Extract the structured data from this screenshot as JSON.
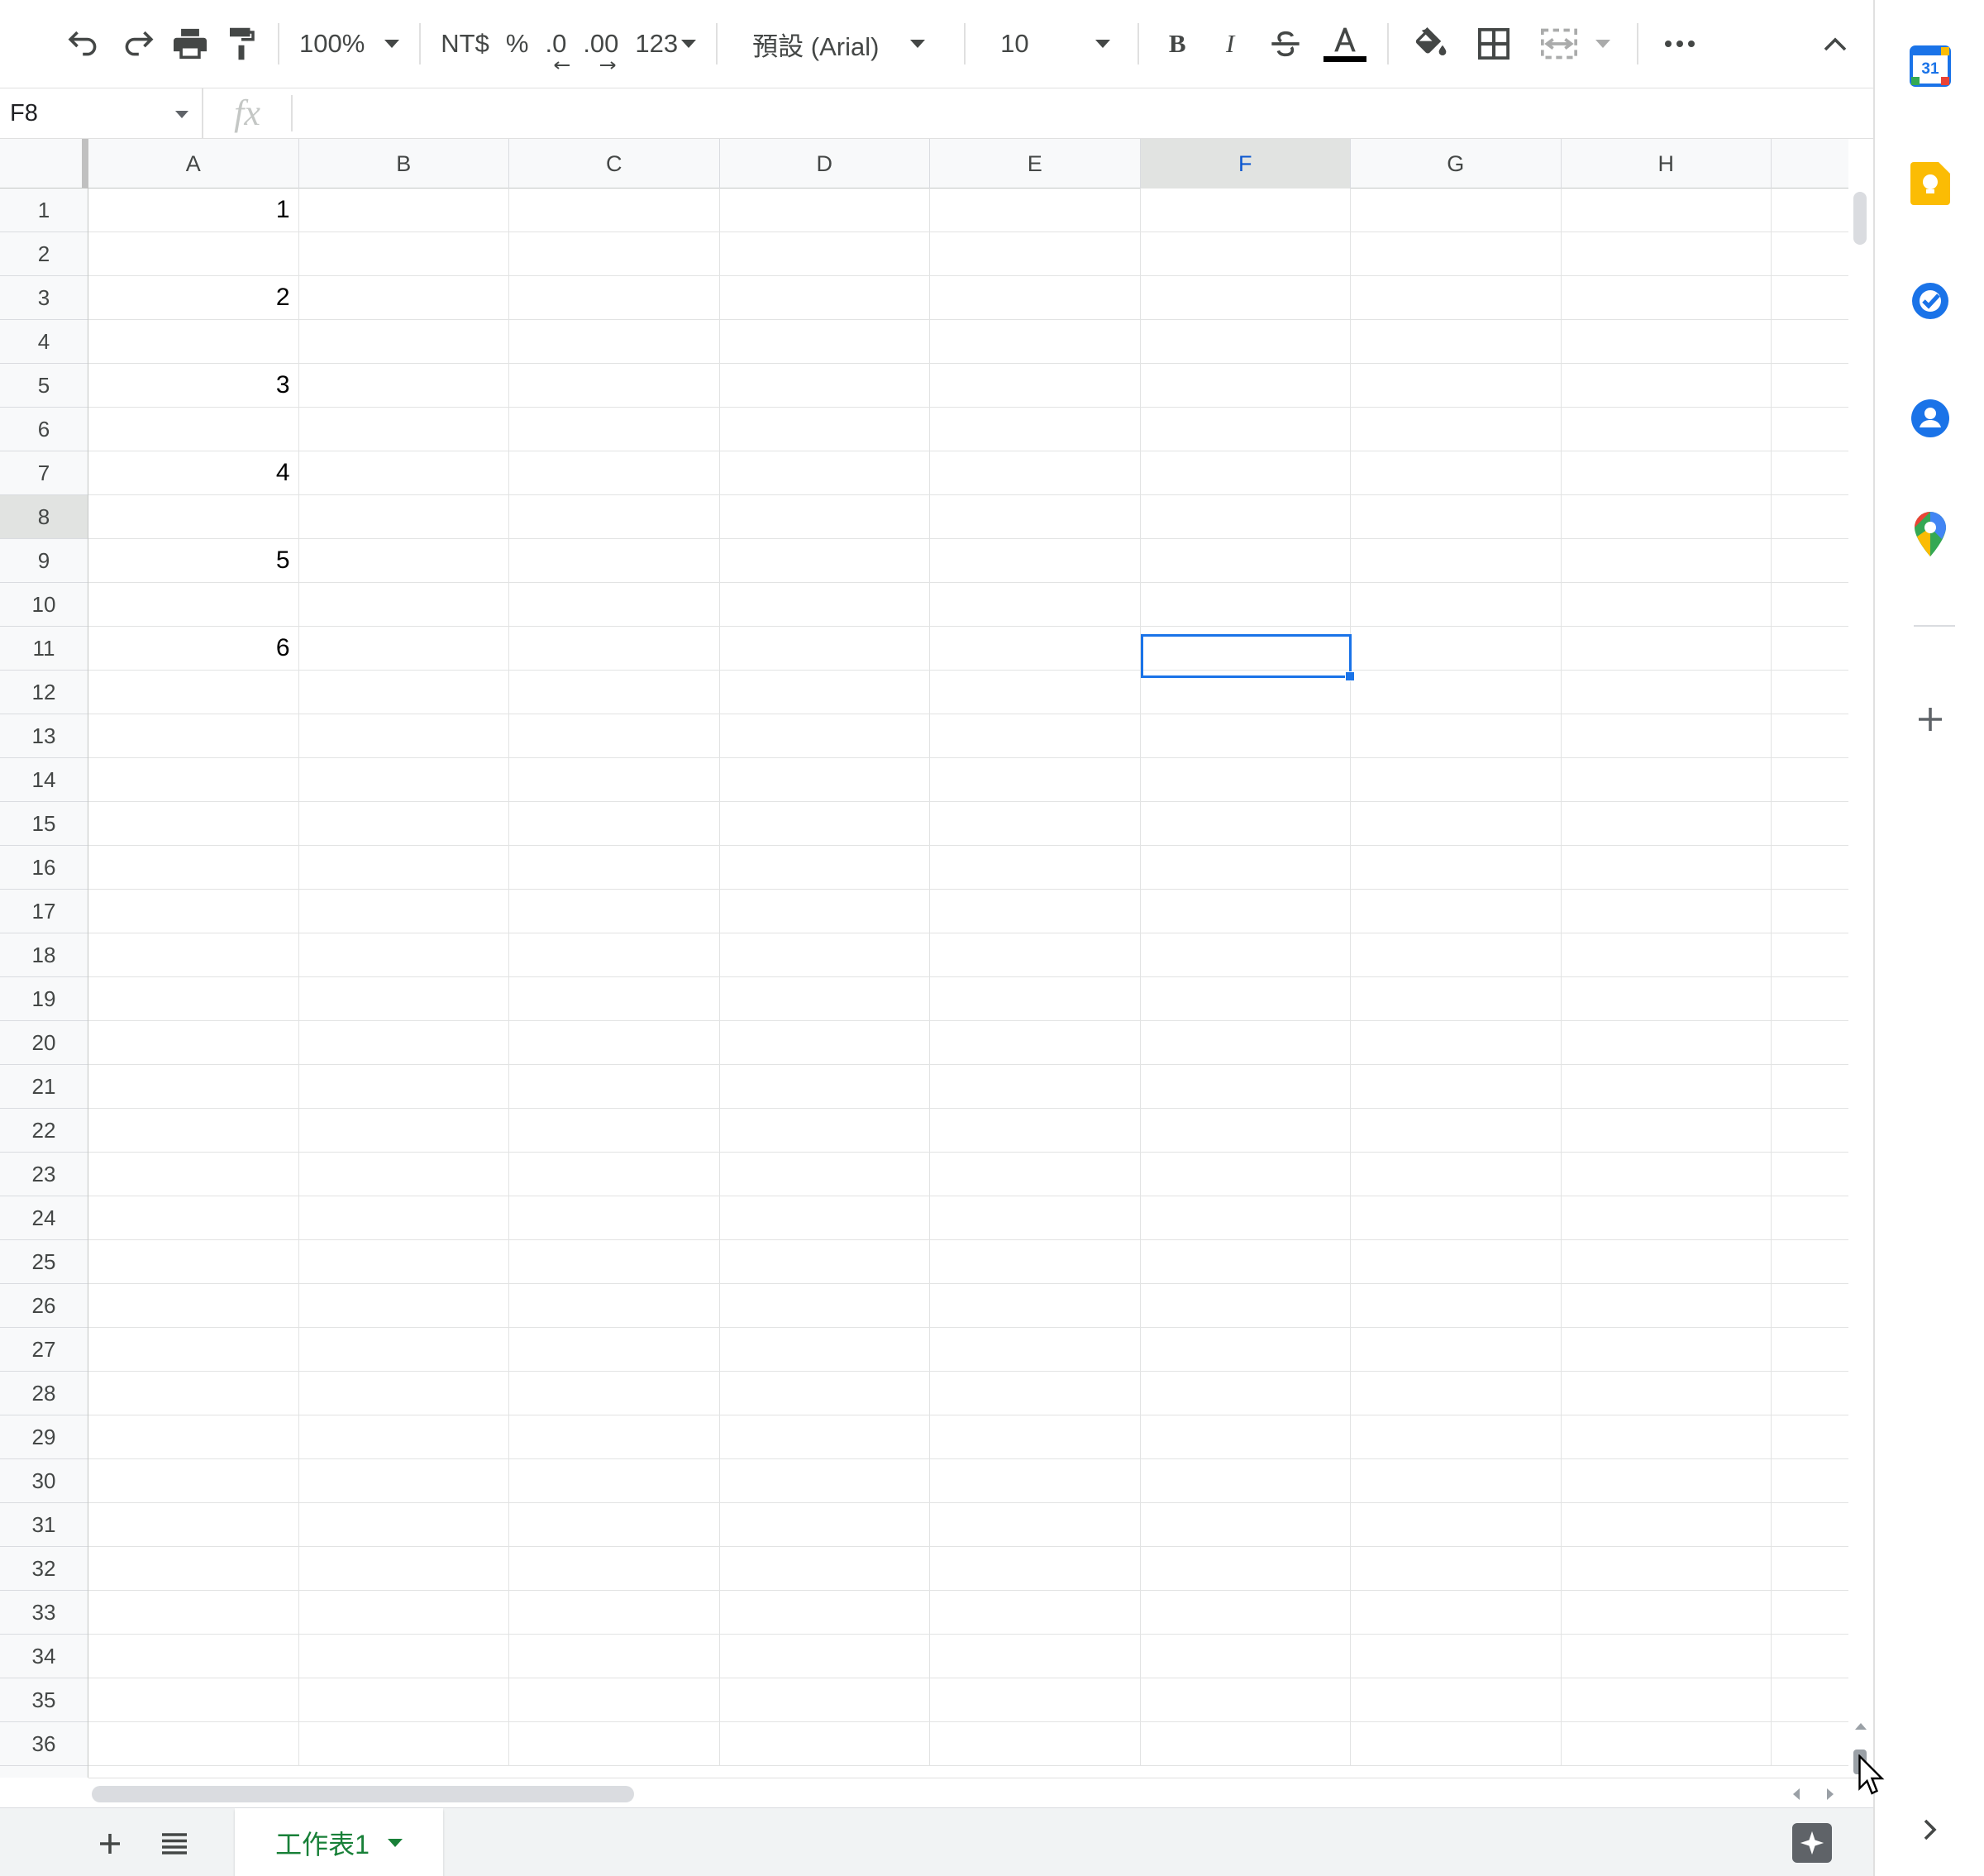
{
  "toolbar": {
    "zoom": "100%",
    "currency": "NT$",
    "percent": "%",
    "dec_decrease": ".0",
    "dec_increase": ".00",
    "more_formats": "123",
    "font": "預設 (Arial)",
    "font_size": "10",
    "bold": "B",
    "italic": "I"
  },
  "formula_bar": {
    "cell_ref": "F8",
    "fx": "fx",
    "value": ""
  },
  "grid": {
    "columns": [
      "A",
      "B",
      "C",
      "D",
      "E",
      "F",
      "G",
      "H"
    ],
    "selected_column": "F",
    "rows": [
      "1",
      "2",
      "3",
      "4",
      "5",
      "6",
      "7",
      "8",
      "9",
      "10",
      "11",
      "12",
      "13",
      "14",
      "15",
      "16",
      "17",
      "18",
      "19",
      "20",
      "21",
      "22",
      "23",
      "24",
      "25",
      "26",
      "27",
      "28",
      "29",
      "30",
      "31",
      "32",
      "33",
      "34",
      "35",
      "36"
    ],
    "selected_row": "8",
    "cells_col_a": [
      "1",
      "",
      "2",
      "",
      "3",
      "",
      "4",
      "",
      "5",
      "",
      "6",
      "",
      "",
      "",
      "",
      "",
      "",
      "",
      "",
      "",
      "",
      "",
      "",
      "",
      "",
      "",
      "",
      "",
      "",
      "",
      "",
      "",
      "",
      "",
      "",
      ""
    ],
    "selected_cell": "F8"
  },
  "sheets": {
    "active_tab": "工作表1"
  },
  "colors": {
    "accent": "#1a73e8",
    "sheet_tab_text": "#188038",
    "header_bg": "#f8f9fa"
  },
  "side_panel": {
    "calendar_day": "31",
    "icons": [
      "calendar-icon",
      "keep-icon",
      "tasks-icon",
      "contacts-icon",
      "maps-icon",
      "add-icon"
    ]
  }
}
